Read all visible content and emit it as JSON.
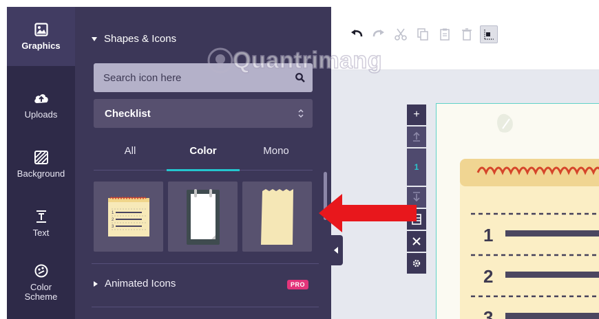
{
  "rail": {
    "items": [
      {
        "label": "Graphics",
        "icon": "image-icon",
        "active": true
      },
      {
        "label": "Uploads",
        "icon": "cloud-upload-icon",
        "active": false
      },
      {
        "label": "Background",
        "icon": "background-pattern-icon",
        "active": false
      },
      {
        "label": "Text",
        "icon": "text-icon",
        "active": false
      },
      {
        "label": "Color\nScheme",
        "icon": "palette-icon",
        "active": false
      }
    ]
  },
  "panel": {
    "section_title": "Shapes & Icons",
    "search": {
      "placeholder": "Search icon here",
      "icon": "search-icon"
    },
    "category_select": {
      "value": "Checklist",
      "icon": "chevron-updown-icon"
    },
    "tabs": [
      {
        "label": "All",
        "active": false
      },
      {
        "label": "Color",
        "active": true
      },
      {
        "label": "Mono",
        "active": false
      }
    ],
    "results": [
      {
        "name": "notepad-checklist"
      },
      {
        "name": "clipboard"
      },
      {
        "name": "torn-paper"
      }
    ],
    "animated_icons": {
      "label": "Animated Icons",
      "badge": "PRO"
    }
  },
  "toolbar": {
    "buttons": [
      {
        "name": "undo-icon",
        "enabled": true
      },
      {
        "name": "redo-icon",
        "enabled": false
      },
      {
        "name": "cut-icon",
        "enabled": false
      },
      {
        "name": "copy-icon",
        "enabled": false
      },
      {
        "name": "paste-icon",
        "enabled": false
      },
      {
        "name": "delete-icon",
        "enabled": false
      },
      {
        "name": "align-icon",
        "enabled": true
      }
    ]
  },
  "page_tools": {
    "current_page": "1",
    "buttons": [
      "add-page-icon",
      "move-up-icon",
      "page-number",
      "move-down-icon",
      "layout-icon",
      "delete-page-icon",
      "settings-icon"
    ]
  },
  "canvas": {
    "list_numbers": [
      "1",
      "2",
      "3"
    ]
  },
  "watermark": "Quantrimang",
  "colors": {
    "rail_bg": "#2e2a48",
    "panel_bg": "#3c3758",
    "accent": "#24c6cf",
    "pro_badge": "#e3357a",
    "arrow": "#e8171c"
  }
}
